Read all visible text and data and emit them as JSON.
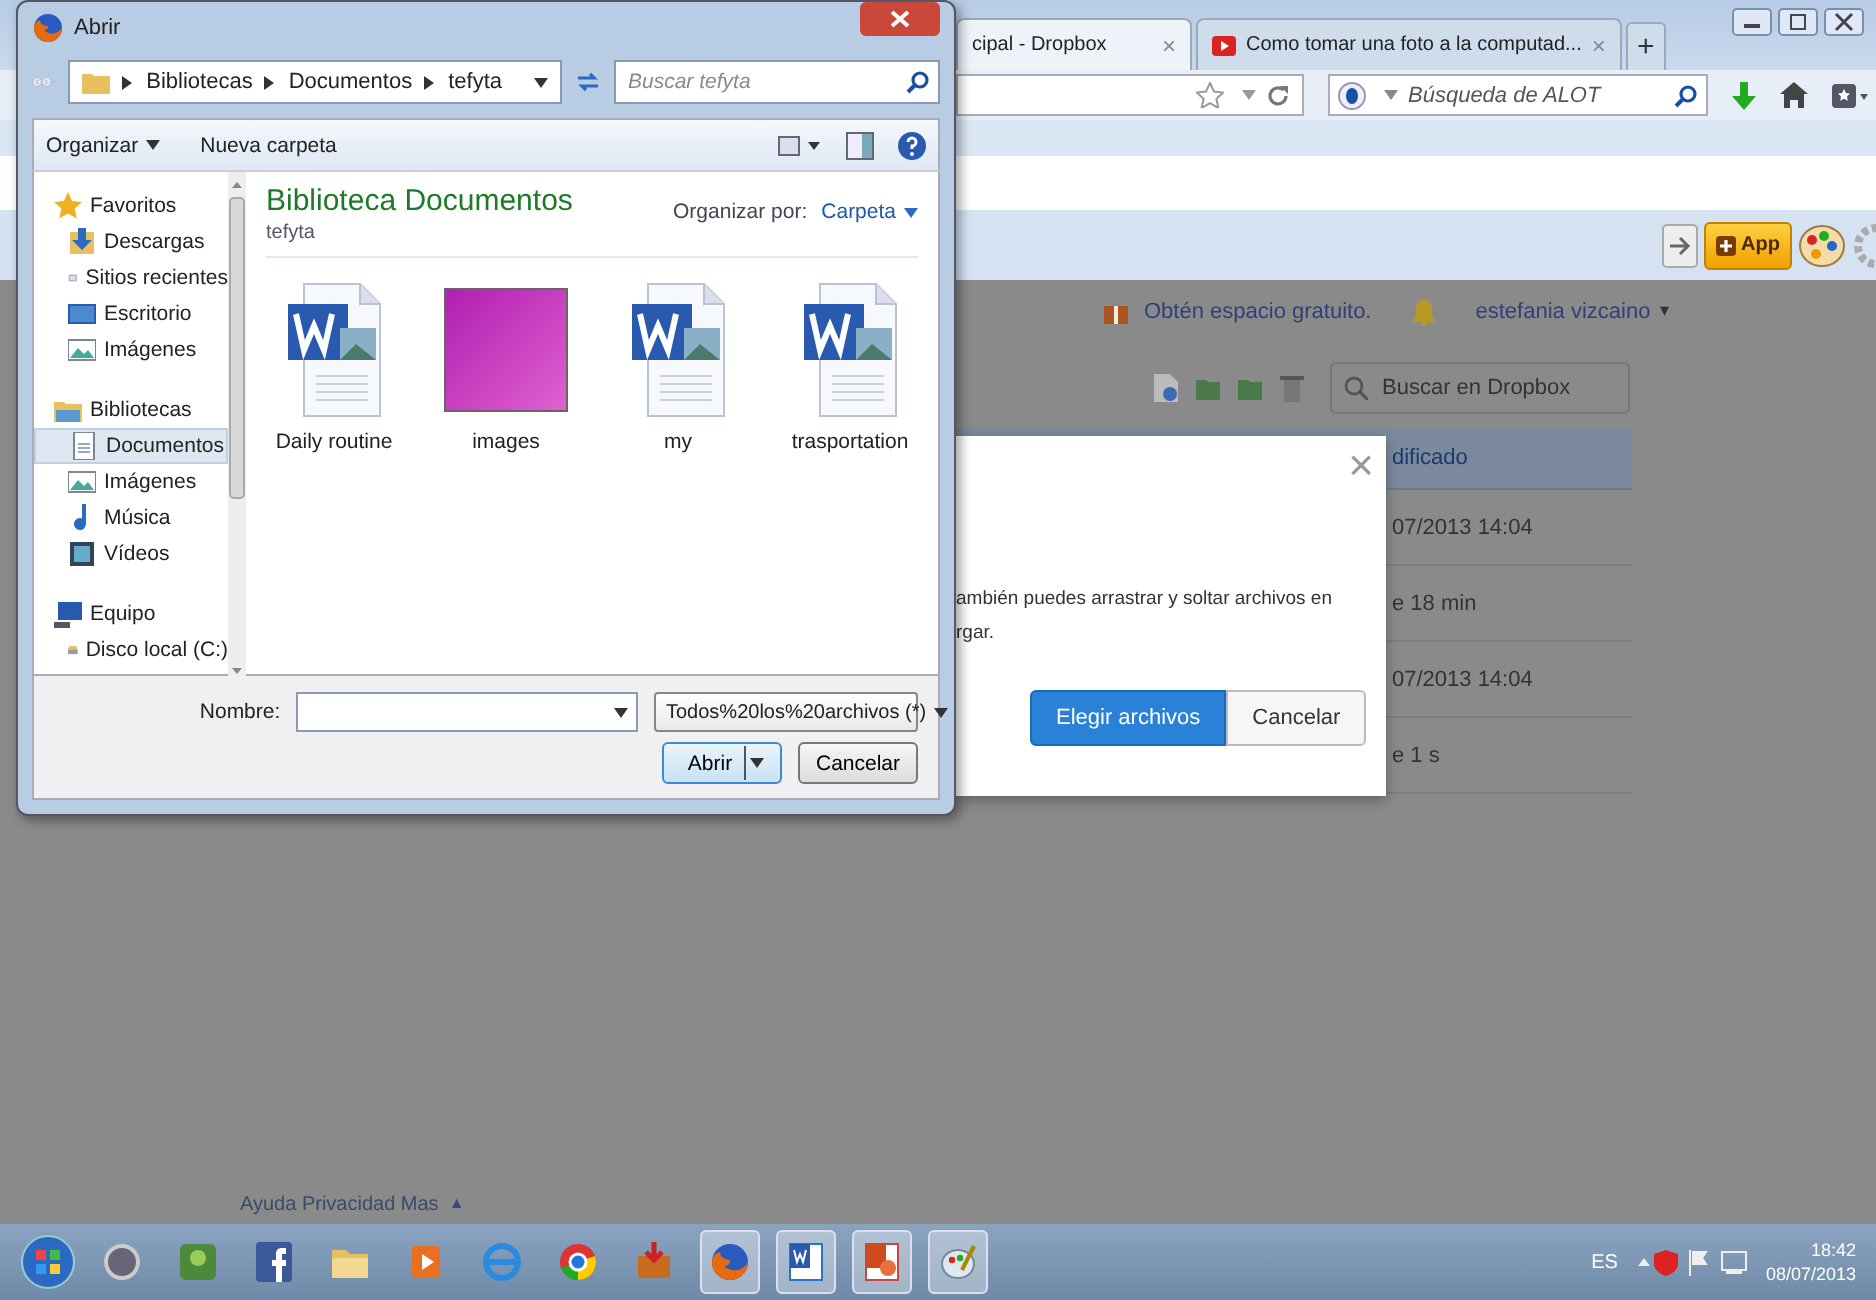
{
  "browser": {
    "tabs": [
      {
        "label": "cipal - Dropbox",
        "selected": true,
        "close": "×"
      },
      {
        "label": "Como tomar una foto a la computad...",
        "selected": false,
        "close": "×"
      }
    ],
    "new_tab": "+",
    "search": {
      "placeholder": "Búsqueda de ALOT"
    },
    "app_button": "App"
  },
  "page": {
    "promo": "Obtén espacio gratuito.",
    "user": "estefania vizcaino",
    "user_caret": "▾",
    "search": {
      "placeholder": "Buscar en Dropbox"
    },
    "column": "dificado",
    "rows": [
      "07/2013 14:04",
      "e 18 min",
      "07/2013 14:04",
      "e 1 s"
    ],
    "footer": "Ayuda Privacidad Mas",
    "footer_caret": "▲"
  },
  "upload_modal": {
    "close": "×",
    "text_lines": [
      "ambién puedes arrastrar y soltar archivos en",
      "rgar."
    ],
    "buttons": [
      {
        "label": "Elegir archivos",
        "kind": "primary"
      },
      {
        "label": "Cancelar",
        "kind": "secondary"
      }
    ]
  },
  "dialog": {
    "title": "Abrir",
    "path": [
      "Bibliotecas",
      "Documentos",
      "tefyta"
    ],
    "search": {
      "placeholder": "Buscar tefyta"
    },
    "toolbar": [
      {
        "label": "Organizar",
        "dropdown": true
      },
      {
        "label": "Nueva carpeta",
        "dropdown": false
      }
    ],
    "nav": [
      {
        "label": "Favoritos",
        "kind": "star",
        "selected": false,
        "children": [
          {
            "label": "Descargas",
            "kind": "download",
            "selected": false
          },
          {
            "label": "Sitios recientes",
            "kind": "recent",
            "selected": false
          },
          {
            "label": "Escritorio",
            "kind": "desktop",
            "selected": false
          },
          {
            "label": "Imágenes",
            "kind": "pictures",
            "selected": false
          }
        ]
      },
      {
        "label": "Bibliotecas",
        "kind": "library",
        "selected": false,
        "children": [
          {
            "label": "Documentos",
            "kind": "document",
            "selected": true
          },
          {
            "label": "Imágenes",
            "kind": "pictures",
            "selected": false
          },
          {
            "label": "Música",
            "kind": "music",
            "selected": false
          },
          {
            "label": "Vídeos",
            "kind": "video",
            "selected": false
          }
        ]
      },
      {
        "label": "Equipo",
        "kind": "computer",
        "selected": false,
        "children": [
          {
            "label": "Disco local (C:)",
            "kind": "disk",
            "selected": false
          }
        ]
      }
    ],
    "library_title": "Biblioteca Documentos",
    "library_subtitle": "tefyta",
    "arrange_label": "Organizar por:",
    "arrange_value": "Carpeta",
    "files": [
      {
        "name": "Daily routine",
        "kind": "word"
      },
      {
        "name": "images",
        "kind": "image"
      },
      {
        "name": "my",
        "kind": "word"
      },
      {
        "name": "trasportation",
        "kind": "word"
      }
    ],
    "filename_label": "Nombre:",
    "filter": "Todos%20los%20archivos (*)",
    "buttons": [
      {
        "label": "Abrir",
        "kind": "split"
      },
      {
        "label": "Cancelar",
        "kind": "plain"
      }
    ]
  },
  "taskbar": {
    "apps": [
      {
        "kind": "media",
        "open": false
      },
      {
        "kind": "game",
        "open": false
      },
      {
        "kind": "facebook",
        "open": false
      },
      {
        "kind": "folder",
        "open": false
      },
      {
        "kind": "player",
        "open": false
      },
      {
        "kind": "ie",
        "open": false
      },
      {
        "kind": "chrome",
        "open": false
      },
      {
        "kind": "box",
        "open": false
      },
      {
        "kind": "firefox",
        "open": true
      },
      {
        "kind": "word",
        "open": true
      },
      {
        "kind": "powerpoint",
        "open": true
      },
      {
        "kind": "paint",
        "open": true
      }
    ],
    "language": "ES",
    "time": "18:42",
    "date": "08/07/2013"
  }
}
